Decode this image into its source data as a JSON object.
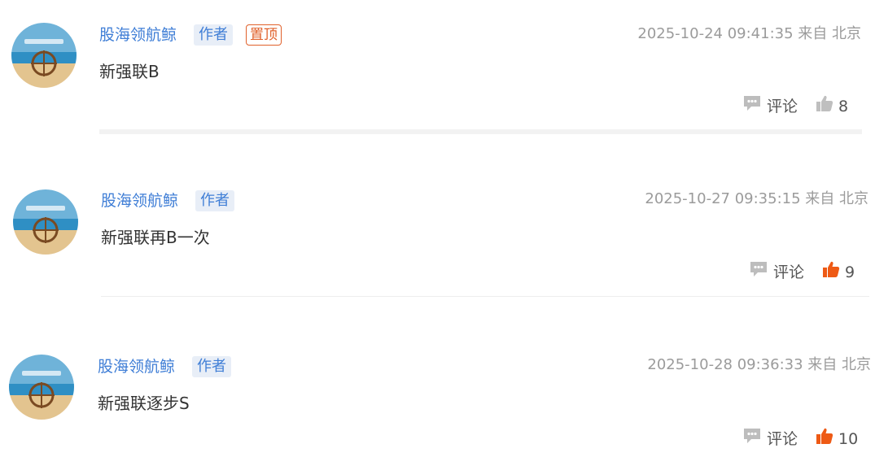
{
  "colors": {
    "author": "#3f7ed6",
    "pin": "#e0602a",
    "like_active": "#ee5a15",
    "like_inactive": "#bfbfbf",
    "comment_icon": "#bdbdbd",
    "meta": "#9b9b9b"
  },
  "posts": [
    {
      "author": "股海领航鲸",
      "author_tag": "作者",
      "pinned_tag": "置顶",
      "meta": "2025-10-24 09:41:35 来自 北京",
      "content": "新强联B",
      "comment_label": "评论",
      "comment_icon": "comment-icon",
      "like_icon": "thumbs-up-icon",
      "likes": "8",
      "liked": false
    },
    {
      "author": "股海领航鲸",
      "author_tag": "作者",
      "meta": "2025-10-27 09:35:15 来自 北京",
      "content": "新强联再B一次",
      "comment_label": "评论",
      "comment_icon": "comment-icon",
      "like_icon": "thumbs-up-icon",
      "likes": "9",
      "liked": true
    },
    {
      "author": "股海领航鲸",
      "author_tag": "作者",
      "meta": "2025-10-28 09:36:33 来自 北京",
      "content": "新强联逐步S",
      "comment_label": "评论",
      "comment_icon": "comment-icon",
      "like_icon": "thumbs-up-icon",
      "likes": "10",
      "liked": true
    }
  ]
}
